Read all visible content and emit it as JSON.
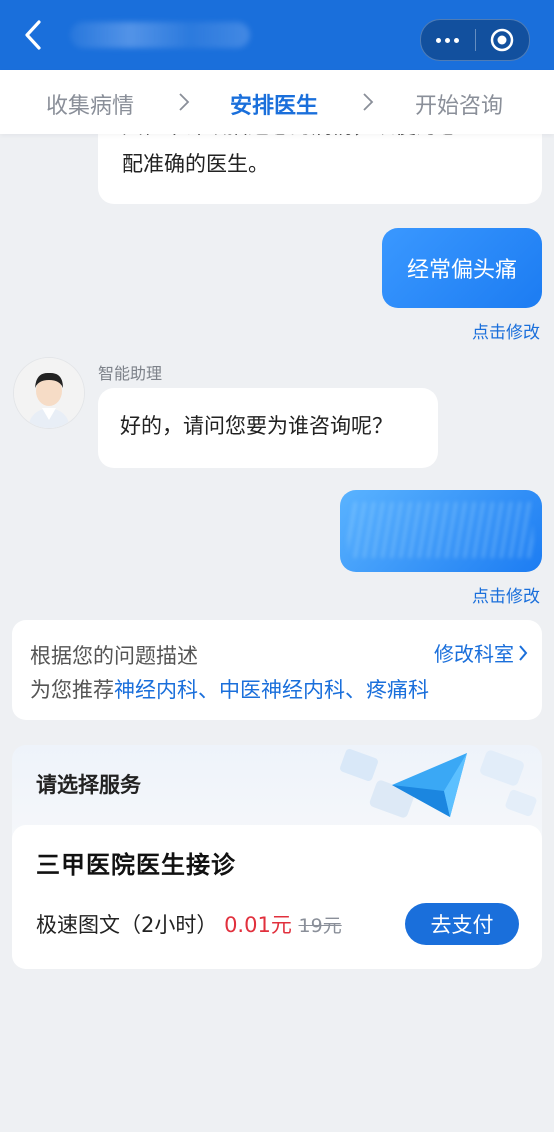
{
  "steps": {
    "step1": "收集病情",
    "step2": "安排医生",
    "step3": "开始咨询"
  },
  "chat": {
    "partial_text_hidden": "大框中详细描述您的病情，以便为您匹",
    "partial_text": "配准确的医生。",
    "user_message_1": "经常偏头痛",
    "edit_link_1": "点击修改",
    "assistant_name": "智能助理",
    "assistant_question": "好的，请问您要为谁咨询呢？",
    "edit_link_2": "点击修改"
  },
  "recommend": {
    "line1": "根据您的问题描述",
    "prefix": "为您推荐",
    "dept1": "神经内科",
    "sep1": "、",
    "dept2": "中医神经内科",
    "sep2": "、",
    "dept3": "疼痛科",
    "edit_label": "修改科室"
  },
  "service": {
    "title": "请选择服务",
    "name": "三甲医院医生接诊",
    "type": "极速图文（2小时）",
    "price": "0.01元",
    "original_price": "19元",
    "pay_label": "去支付"
  },
  "colors": {
    "primary": "#1a6fdb",
    "price_red": "#e1303d",
    "background": "#eef0f3"
  }
}
